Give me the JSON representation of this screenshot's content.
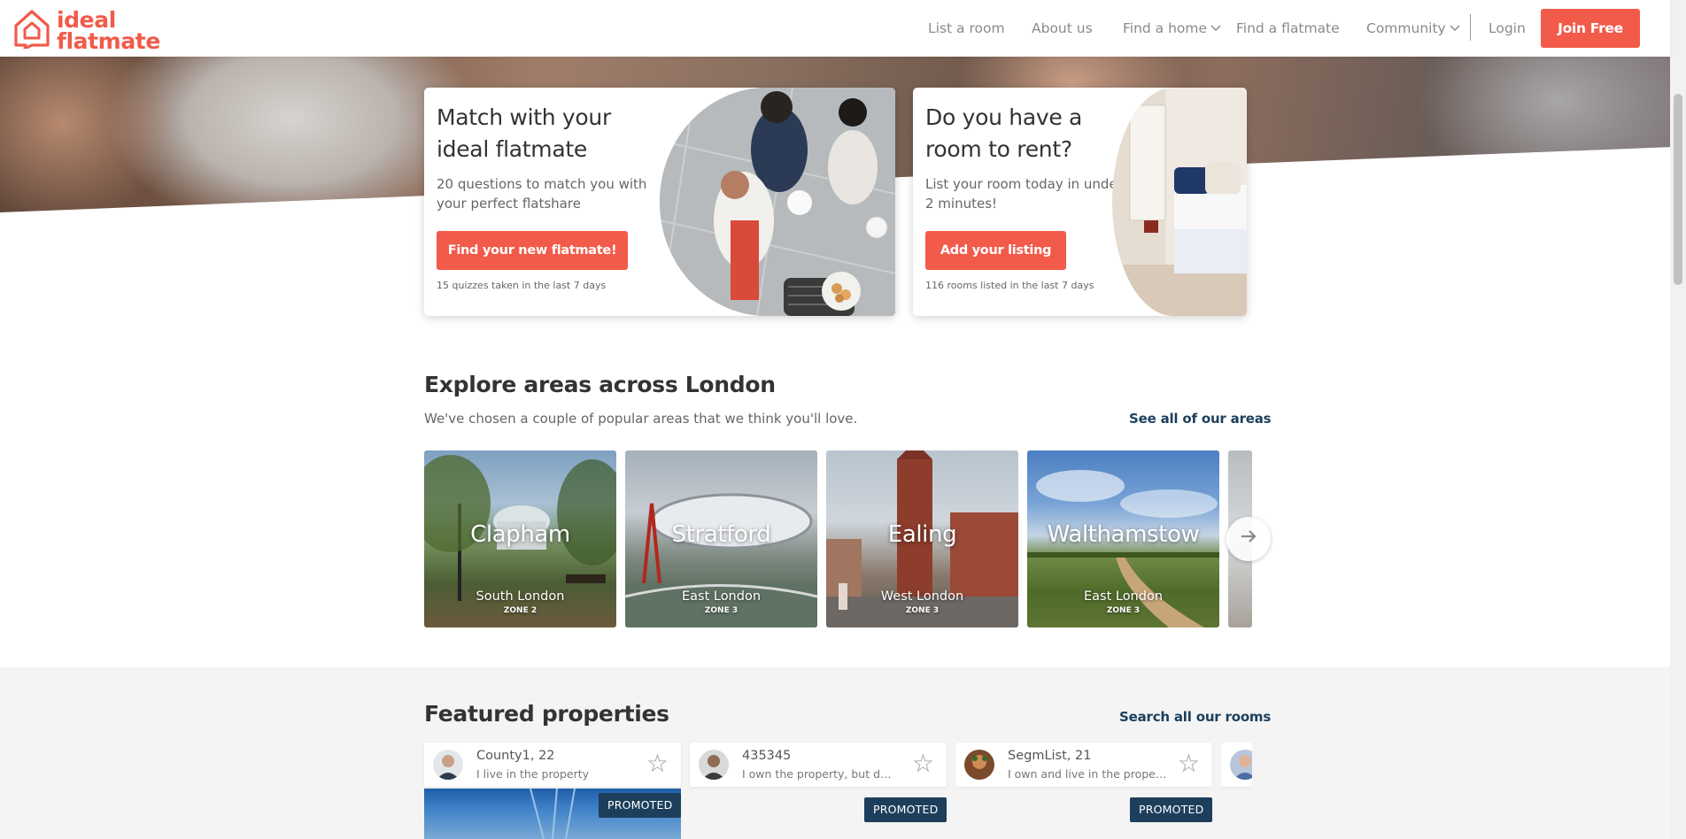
{
  "brand": {
    "line1": "ideal",
    "line2": "flatmate",
    "color": "#f25a4a"
  },
  "nav": {
    "list_room": "List a room",
    "about": "About us",
    "find_home": "Find a home",
    "find_flatmate": "Find a flatmate",
    "community": "Community",
    "login": "Login",
    "join": "Join Free"
  },
  "cards": {
    "match": {
      "title_line1": "Match with your",
      "title_line2": "ideal flatmate",
      "desc_line1": "20 questions to match you with",
      "desc_line2": "your perfect flatshare",
      "button": "Find your new flatmate!",
      "note": "15 quizzes taken in the last 7 days"
    },
    "room": {
      "title_line1": "Do you have a",
      "title_line2": "room to rent?",
      "desc_line1": "List your room today in under",
      "desc_line2": "2 minutes!",
      "button": "Add your listing",
      "note": "116 rooms listed in the last 7 days"
    }
  },
  "explore": {
    "title": "Explore areas across London",
    "subtitle": "We've chosen a couple of popular areas that we think you'll love.",
    "link": "See all of our areas",
    "areas": [
      {
        "name": "Clapham",
        "region": "South London",
        "zone": "ZONE 2"
      },
      {
        "name": "Stratford",
        "region": "East London",
        "zone": "ZONE 3"
      },
      {
        "name": "Ealing",
        "region": "West London",
        "zone": "ZONE 3"
      },
      {
        "name": "Walthamstow",
        "region": "East London",
        "zone": "ZONE 3"
      }
    ],
    "next_icon": "arrow-right-icon"
  },
  "featured": {
    "title": "Featured properties",
    "link": "Search all our rooms",
    "properties": [
      {
        "name": "County1, 22",
        "detail": "I live in the property",
        "badge": "PROMOTED"
      },
      {
        "name": "435345",
        "detail": "I own the property, but don't live there",
        "badge": "PROMOTED"
      },
      {
        "name": "SegmList, 21",
        "detail": "I own and live in the property",
        "badge": "PROMOTED"
      }
    ]
  },
  "colors": {
    "accent": "#f25a4a",
    "navy": "#1d3f5c"
  }
}
